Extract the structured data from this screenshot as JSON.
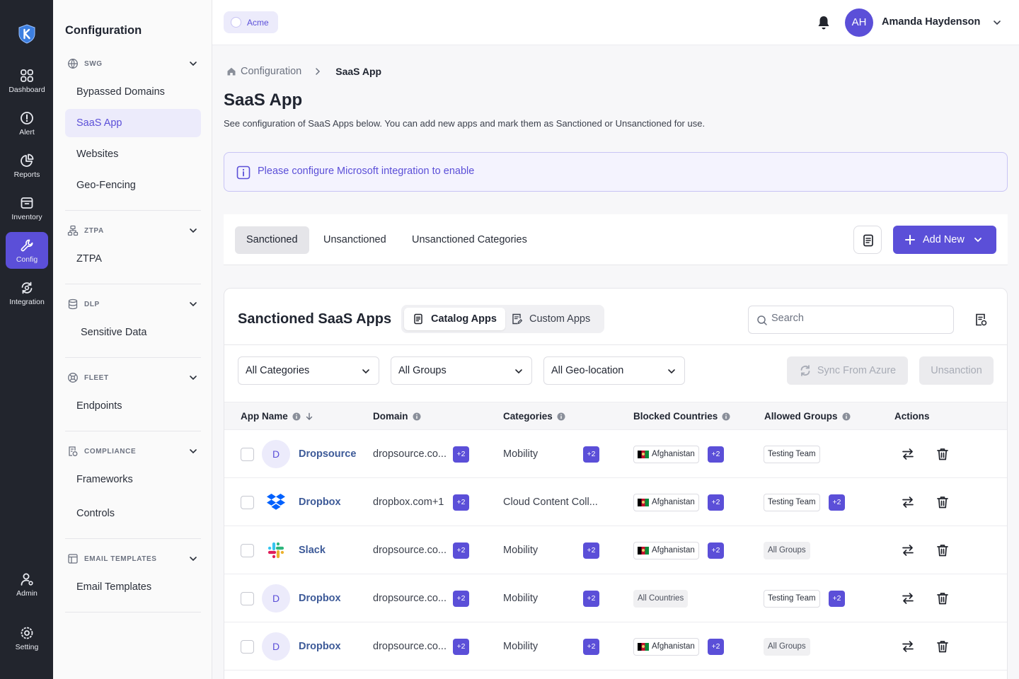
{
  "rail": {
    "items": [
      {
        "label": "Dashboard",
        "icon": "dashboard-icon"
      },
      {
        "label": "Alert",
        "icon": "alert-icon"
      },
      {
        "label": "Reports",
        "icon": "reports-icon"
      },
      {
        "label": "Inventory",
        "icon": "inventory-icon"
      },
      {
        "label": "Config",
        "icon": "config-icon",
        "active": true
      },
      {
        "label": "Integration",
        "icon": "integration-icon"
      },
      {
        "label": "Admin",
        "icon": "admin-icon"
      },
      {
        "label": "Setting",
        "icon": "setting-icon"
      }
    ]
  },
  "sidebar": {
    "title": "Configuration",
    "sections": [
      {
        "head": "SWG",
        "items": [
          "Bypassed Domains",
          "SaaS App",
          "Websites",
          "Geo-Fencing"
        ]
      },
      {
        "head": "ZTPA",
        "items": [
          "ZTPA"
        ]
      },
      {
        "head": "DLP",
        "items": [
          "Sensitive Data"
        ]
      },
      {
        "head": "FLEET",
        "items": [
          "Endpoints"
        ]
      },
      {
        "head": "COMPLIANCE",
        "items": [
          "Frameworks",
          "Controls"
        ]
      },
      {
        "head": "EMAIL TEMPLATES",
        "items": [
          "Email Templates"
        ]
      }
    ],
    "active_item": "SaaS App"
  },
  "topbar": {
    "org": "Acme",
    "user_initials": "AH",
    "user_name": "Amanda Haydenson"
  },
  "breadcrumb": {
    "parent": "Configuration",
    "current": "SaaS App"
  },
  "page": {
    "title": "SaaS App",
    "subtitle": "See configuration of SaaS Apps below. You can add new apps and mark them as Sanctioned or Unsanctioned for use."
  },
  "info_banner": "Please configure Microsoft integration to enable",
  "tabs": [
    "Sanctioned",
    "Unsanctioned",
    "Unsanctioned Categories"
  ],
  "add_new_label": "Add New",
  "card": {
    "title": "Sanctioned SaaS Apps",
    "segments": [
      "Catalog Apps",
      "Custom Apps"
    ],
    "search_placeholder": "Search",
    "filters": [
      "All Categories",
      "All Groups",
      "All Geo-location"
    ],
    "sync_label": "Sync From Azure",
    "unsanction_label": "Unsanction"
  },
  "table": {
    "columns": [
      "App Name",
      "Domain",
      "Categories",
      "Blocked Countries",
      "Allowed Groups",
      "Actions"
    ],
    "rows": [
      {
        "logo": "initial",
        "initial": "D",
        "name": "Dropsource",
        "domain": "dropsource.co...",
        "domain_more": "+2",
        "category": "Mobility",
        "category_more": "+2",
        "country": "Afghanistan",
        "country_flag": true,
        "country_more": "+2",
        "group": "Testing Team",
        "group_style": "outline",
        "group_more": ""
      },
      {
        "logo": "dropbox",
        "initial": "",
        "name": "Dropbox",
        "domain": "dropbox.com+1",
        "domain_more": "+2",
        "category": "Cloud Content Coll...",
        "category_more": "",
        "country": "Afghanistan",
        "country_flag": true,
        "country_more": "+2",
        "group": "Testing Team",
        "group_style": "outline",
        "group_more": "+2"
      },
      {
        "logo": "slack",
        "initial": "",
        "name": "Slack",
        "domain": "dropsource.co...",
        "domain_more": "+2",
        "category": "Mobility",
        "category_more": "+2",
        "country": "Afghanistan",
        "country_flag": true,
        "country_more": "+2",
        "group": "All Groups",
        "group_style": "grey",
        "group_more": ""
      },
      {
        "logo": "initial",
        "initial": "D",
        "name": "Dropbox",
        "domain": "dropsource.co...",
        "domain_more": "+2",
        "category": "Mobility",
        "category_more": "+2",
        "country": "All Countries",
        "country_flag": false,
        "country_more": "",
        "group": "Testing Team",
        "group_style": "outline",
        "group_more": "+2"
      },
      {
        "logo": "initial",
        "initial": "D",
        "name": "Dropbox",
        "domain": "dropsource.co...",
        "domain_more": "+2",
        "category": "Mobility",
        "category_more": "+2",
        "country": "Afghanistan",
        "country_flag": true,
        "country_more": "+2",
        "group": "All Groups",
        "group_style": "grey",
        "group_more": ""
      }
    ]
  },
  "colors": {
    "accent": "#5b4fd8",
    "rail": "#22252d",
    "link": "#3d5a98"
  }
}
